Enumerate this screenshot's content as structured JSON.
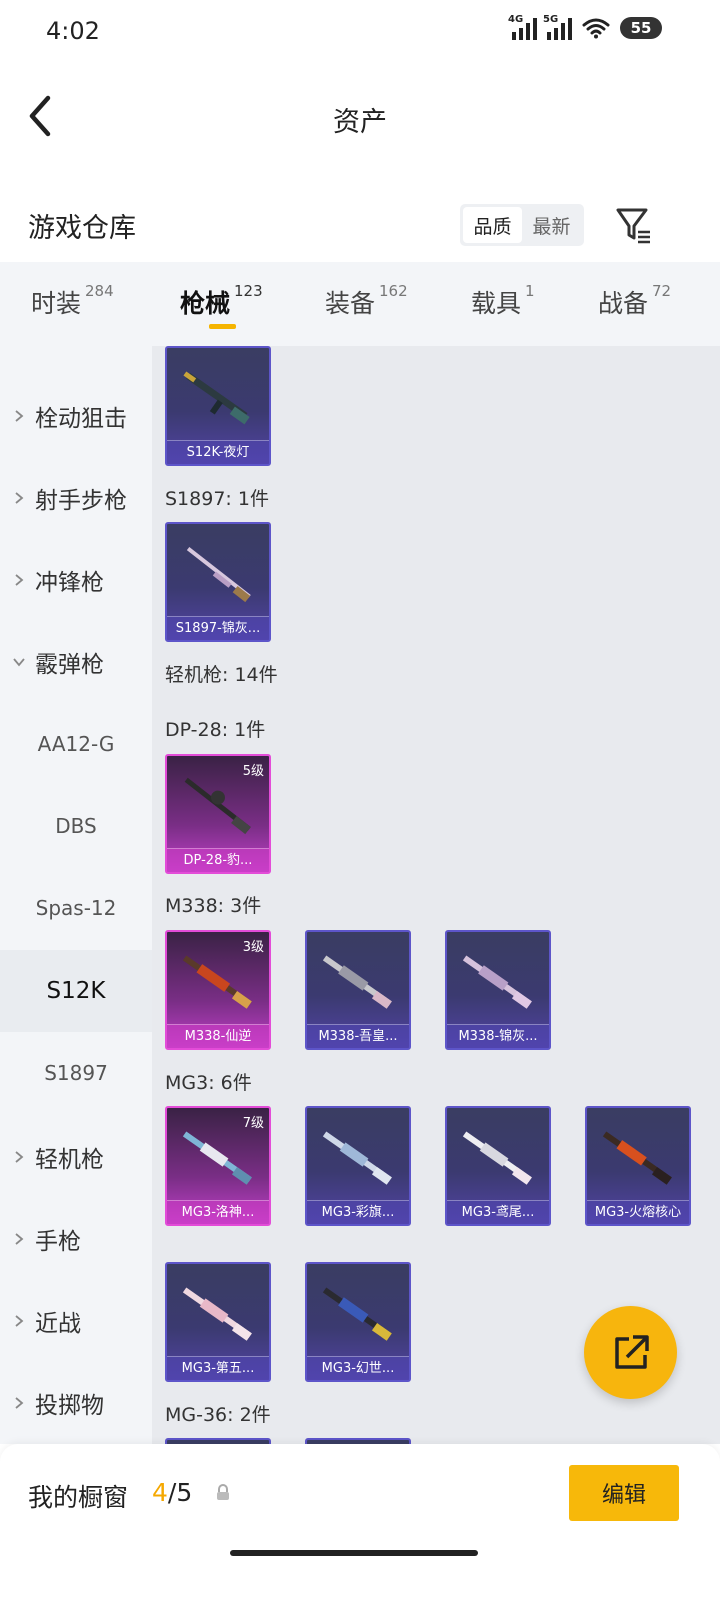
{
  "status": {
    "time": "4:02",
    "net1": "4G",
    "net2": "5G",
    "battery": "55"
  },
  "header": {
    "title": "资产"
  },
  "warehouse": {
    "title": "游戏仓库",
    "sort_quality": "品质",
    "sort_newest": "最新"
  },
  "tabs": [
    {
      "label": "时装",
      "count": "284"
    },
    {
      "label": "枪械",
      "count": "123"
    },
    {
      "label": "装备",
      "count": "162"
    },
    {
      "label": "载具",
      "count": "1"
    },
    {
      "label": "战备",
      "count": "72"
    }
  ],
  "sidebar": {
    "categories": [
      "栓动狙击",
      "射手步枪",
      "冲锋枪",
      "霰弹枪",
      "轻机枪",
      "手枪",
      "近战",
      "投掷物"
    ],
    "subcategories": [
      "AA12-G",
      "DBS",
      "Spas-12",
      "S12K",
      "S1897"
    ]
  },
  "content": {
    "groups": [
      "S1897: 1件",
      "轻机枪: 14件",
      "DP-28: 1件",
      "M338: 3件",
      "MG3: 6件",
      "MG-36: 2件"
    ],
    "cards": [
      {
        "name": "S12K-夜灯",
        "level": ""
      },
      {
        "name": "S1897-锦灰...",
        "level": ""
      },
      {
        "name": "DP-28-豹...",
        "level": "5级"
      },
      {
        "name": "M338-仙逆",
        "level": "3级"
      },
      {
        "name": "M338-吾皇...",
        "level": ""
      },
      {
        "name": "M338-锦灰...",
        "level": ""
      },
      {
        "name": "MG3-洛神...",
        "level": "7级"
      },
      {
        "name": "MG3-彩旗...",
        "level": ""
      },
      {
        "name": "MG3-鸢尾...",
        "level": ""
      },
      {
        "name": "MG3-火熔核心",
        "level": ""
      },
      {
        "name": "MG3-第五...",
        "level": ""
      },
      {
        "name": "MG3-幻世...",
        "level": ""
      }
    ]
  },
  "bottom": {
    "showcase_label": "我的橱窗",
    "showcase_current": "4",
    "showcase_total": "/5",
    "edit_label": "编辑"
  },
  "colors": {
    "accent": "#f5b400",
    "rare_pink": "#e34cd8",
    "rare_blue": "#5d55c9"
  },
  "icons": [
    "back-arrow-icon",
    "filter-icon",
    "chevron-right-icon",
    "chevron-down-icon",
    "external-link-icon",
    "lock-icon",
    "wifi-icon",
    "signal-icon"
  ]
}
